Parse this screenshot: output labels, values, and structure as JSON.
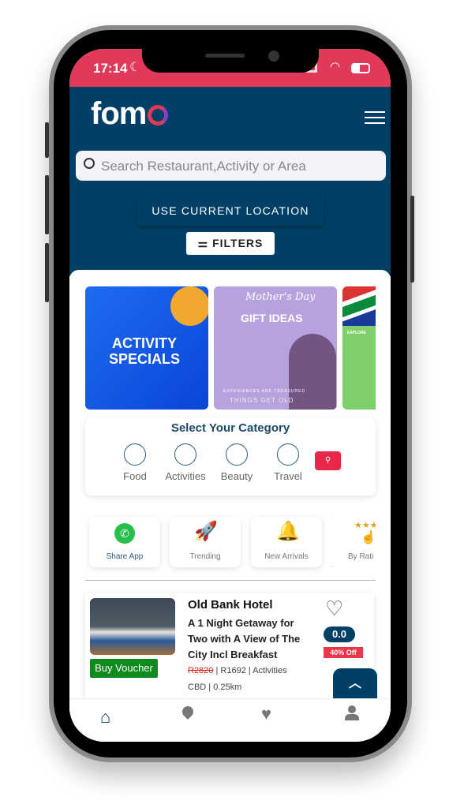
{
  "status_bar": {
    "time": "17:14"
  },
  "header": {
    "logo": "fomo",
    "search_placeholder": "Search Restaurant,Activity or Area",
    "location_button": "USE CURRENT LOCATION",
    "filters_button": "FILTERS"
  },
  "banners": [
    {
      "title": "ACTIVITY SPECIALS"
    },
    {
      "script": "Mother's Day",
      "title": "GIFT IDEAS",
      "tagline": "EXPERIENCES ARE TREASURED",
      "sub": "THINGS GET OLD"
    },
    {
      "title": "EXPLORE"
    }
  ],
  "category": {
    "title": "Select Your Category",
    "items": [
      "Food",
      "Activities",
      "Beauty",
      "Travel"
    ]
  },
  "quick_links": [
    "Share App",
    "Trending",
    "New Arrivals",
    "By Rati"
  ],
  "listing": {
    "name": "Old Bank Hotel",
    "description": "A 1 Night Getaway for Two with A View of The City Incl Breakfast",
    "old_price": "R2820",
    "price_info": " | R1692 | Activities",
    "location": "CBD | 0.25km",
    "rating": "0.0",
    "discount": "40% Off",
    "buy_button": "Buy Voucher"
  },
  "colors": {
    "brand_navy": "#003f66",
    "brand_red": "#e0395a",
    "buy_green": "#0f8a1e"
  }
}
